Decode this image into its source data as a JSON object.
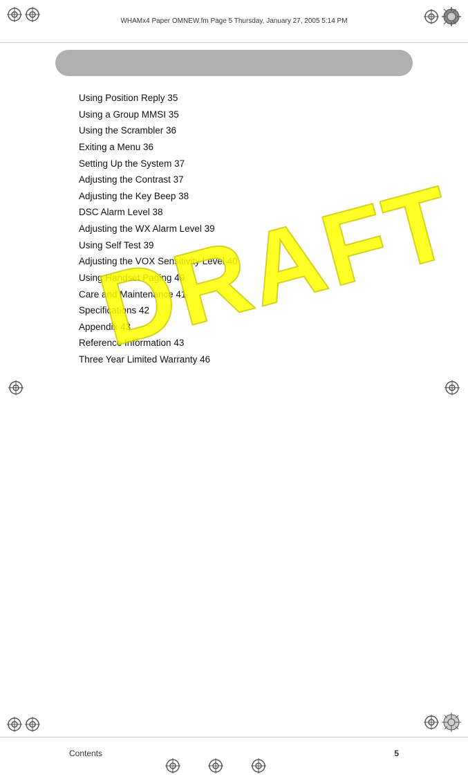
{
  "page": {
    "title": "WHAMx4 Paper OMNEW.fm  Page 5  Thursday, January 27, 2005  5:14 PM",
    "draft_watermark": "DRAFT",
    "header_bar_color": "#b0b0b0",
    "bottom_label": "Contents",
    "bottom_page": "5"
  },
  "content": {
    "items": [
      "Using Position Reply 35",
      "Using a Group MMSI 35",
      "Using the Scrambler 36",
      "Exiting a Menu 36",
      "Setting Up the System 37",
      "Adjusting the Contrast 37",
      "Adjusting the Key Beep 38",
      "DSC Alarm Level 38",
      "Adjusting the WX Alarm Level 39",
      "Using Self Test 39",
      "Adjusting the VOX Sensitivity Level 40",
      "Using Handset Paging 40",
      "Care and Maintenance 41",
      "Specifications 42",
      "Appendix 43",
      "Reference Information 43",
      "Three Year Limited Warranty 46"
    ]
  }
}
